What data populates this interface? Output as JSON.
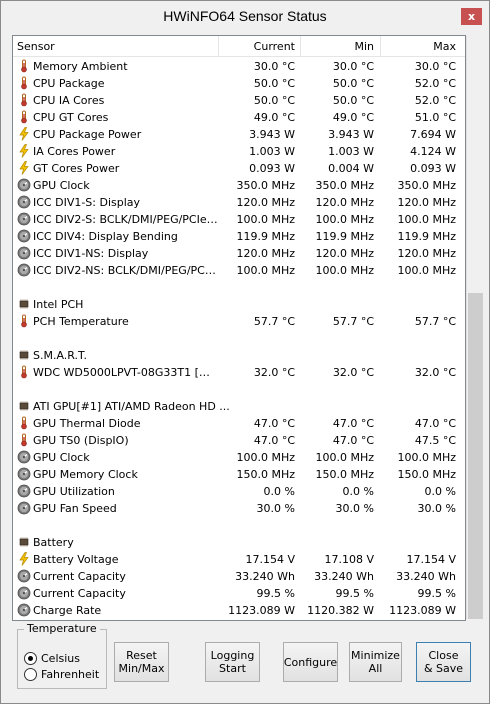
{
  "window": {
    "title": "HWiNFO64 Sensor Status",
    "close_glyph": "x"
  },
  "columns": {
    "sensor": "Sensor",
    "current": "Current",
    "min": "Min",
    "max": "Max"
  },
  "rows": [
    {
      "kind": "data",
      "icon": "thermometer",
      "name": "Memory Ambient",
      "cur": "30.0 °C",
      "min": "30.0 °C",
      "max": "30.0 °C"
    },
    {
      "kind": "data",
      "icon": "thermometer",
      "name": "CPU Package",
      "cur": "50.0 °C",
      "min": "50.0 °C",
      "max": "52.0 °C"
    },
    {
      "kind": "data",
      "icon": "thermometer",
      "name": "CPU IA Cores",
      "cur": "50.0 °C",
      "min": "50.0 °C",
      "max": "52.0 °C"
    },
    {
      "kind": "data",
      "icon": "thermometer",
      "name": "CPU GT Cores",
      "cur": "49.0 °C",
      "min": "49.0 °C",
      "max": "51.0 °C"
    },
    {
      "kind": "data",
      "icon": "lightning",
      "name": "CPU Package Power",
      "cur": "3.943 W",
      "min": "3.943 W",
      "max": "7.694 W"
    },
    {
      "kind": "data",
      "icon": "lightning",
      "name": "IA Cores Power",
      "cur": "1.003 W",
      "min": "1.003 W",
      "max": "4.124 W"
    },
    {
      "kind": "data",
      "icon": "lightning",
      "name": "GT Cores Power",
      "cur": "0.093 W",
      "min": "0.004 W",
      "max": "0.093 W"
    },
    {
      "kind": "data",
      "icon": "gauge",
      "name": "GPU Clock",
      "cur": "350.0 MHz",
      "min": "350.0 MHz",
      "max": "350.0 MHz"
    },
    {
      "kind": "data",
      "icon": "gauge",
      "name": "ICC DIV1-S: Display",
      "cur": "120.0 MHz",
      "min": "120.0 MHz",
      "max": "120.0 MHz"
    },
    {
      "kind": "data",
      "icon": "gauge",
      "name": "ICC DIV2-S: BCLK/DMI/PEG/PCIe/P...",
      "cur": "100.0 MHz",
      "min": "100.0 MHz",
      "max": "100.0 MHz"
    },
    {
      "kind": "data",
      "icon": "gauge",
      "name": "ICC DIV4: Display Bending",
      "cur": "119.9 MHz",
      "min": "119.9 MHz",
      "max": "119.9 MHz"
    },
    {
      "kind": "data",
      "icon": "gauge",
      "name": "ICC DIV1-NS: Display",
      "cur": "120.0 MHz",
      "min": "120.0 MHz",
      "max": "120.0 MHz"
    },
    {
      "kind": "data",
      "icon": "gauge",
      "name": "ICC DIV2-NS: BCLK/DMI/PEG/PCIe/...",
      "cur": "100.0 MHz",
      "min": "100.0 MHz",
      "max": "100.0 MHz"
    },
    {
      "kind": "blank"
    },
    {
      "kind": "group",
      "icon": "chip",
      "name": "Intel PCH"
    },
    {
      "kind": "data",
      "icon": "thermometer",
      "name": "PCH Temperature",
      "cur": "57.7 °C",
      "min": "57.7 °C",
      "max": "57.7 °C"
    },
    {
      "kind": "blank"
    },
    {
      "kind": "group",
      "icon": "chip",
      "name": "S.M.A.R.T."
    },
    {
      "kind": "data",
      "icon": "thermometer",
      "name": "WDC WD5000LPVT-08G33T1 [WD-...",
      "cur": "32.0 °C",
      "min": "32.0 °C",
      "max": "32.0 °C"
    },
    {
      "kind": "blank"
    },
    {
      "kind": "group",
      "icon": "chip",
      "name": "ATI GPU[#1] ATI/AMD Radeon HD ..."
    },
    {
      "kind": "data",
      "icon": "thermometer",
      "name": "GPU Thermal Diode",
      "cur": "47.0 °C",
      "min": "47.0 °C",
      "max": "47.0 °C"
    },
    {
      "kind": "data",
      "icon": "thermometer",
      "name": "GPU TS0 (DispIO)",
      "cur": "47.0 °C",
      "min": "47.0 °C",
      "max": "47.5 °C"
    },
    {
      "kind": "data",
      "icon": "gauge",
      "name": "GPU Clock",
      "cur": "100.0 MHz",
      "min": "100.0 MHz",
      "max": "100.0 MHz"
    },
    {
      "kind": "data",
      "icon": "gauge",
      "name": "GPU Memory Clock",
      "cur": "150.0 MHz",
      "min": "150.0 MHz",
      "max": "150.0 MHz"
    },
    {
      "kind": "data",
      "icon": "gauge",
      "name": "GPU Utilization",
      "cur": "0.0 %",
      "min": "0.0 %",
      "max": "0.0 %"
    },
    {
      "kind": "data",
      "icon": "gauge",
      "name": "GPU Fan Speed",
      "cur": "30.0 %",
      "min": "30.0 %",
      "max": "30.0 %"
    },
    {
      "kind": "blank"
    },
    {
      "kind": "group",
      "icon": "chip",
      "name": "Battery"
    },
    {
      "kind": "data",
      "icon": "lightning",
      "name": "Battery Voltage",
      "cur": "17.154 V",
      "min": "17.108 V",
      "max": "17.154 V"
    },
    {
      "kind": "data",
      "icon": "gauge",
      "name": "Current Capacity",
      "cur": "33.240 Wh",
      "min": "33.240 Wh",
      "max": "33.240 Wh"
    },
    {
      "kind": "data",
      "icon": "gauge",
      "name": "Current Capacity",
      "cur": "99.5 %",
      "min": "99.5 %",
      "max": "99.5 %"
    },
    {
      "kind": "data",
      "icon": "gauge",
      "name": "Charge Rate",
      "cur": "1123.089 W",
      "min": "1120.382 W",
      "max": "1123.089 W"
    }
  ],
  "temperature": {
    "label": "Temperature",
    "options": [
      {
        "label": "Celsius",
        "selected": true
      },
      {
        "label": "Fahrenheit",
        "selected": false
      }
    ]
  },
  "buttons": {
    "reset": [
      "Reset",
      "Min/Max"
    ],
    "logging": [
      "Logging",
      "Start"
    ],
    "configure": [
      "Configure"
    ],
    "minimize": [
      "Minimize",
      "All"
    ],
    "close_save": [
      "Close",
      "& Save"
    ]
  },
  "colors": {
    "close_button": "#c75050",
    "scroll_thumb": "#cdcdcd",
    "window_bg": "#f0f0f0"
  }
}
